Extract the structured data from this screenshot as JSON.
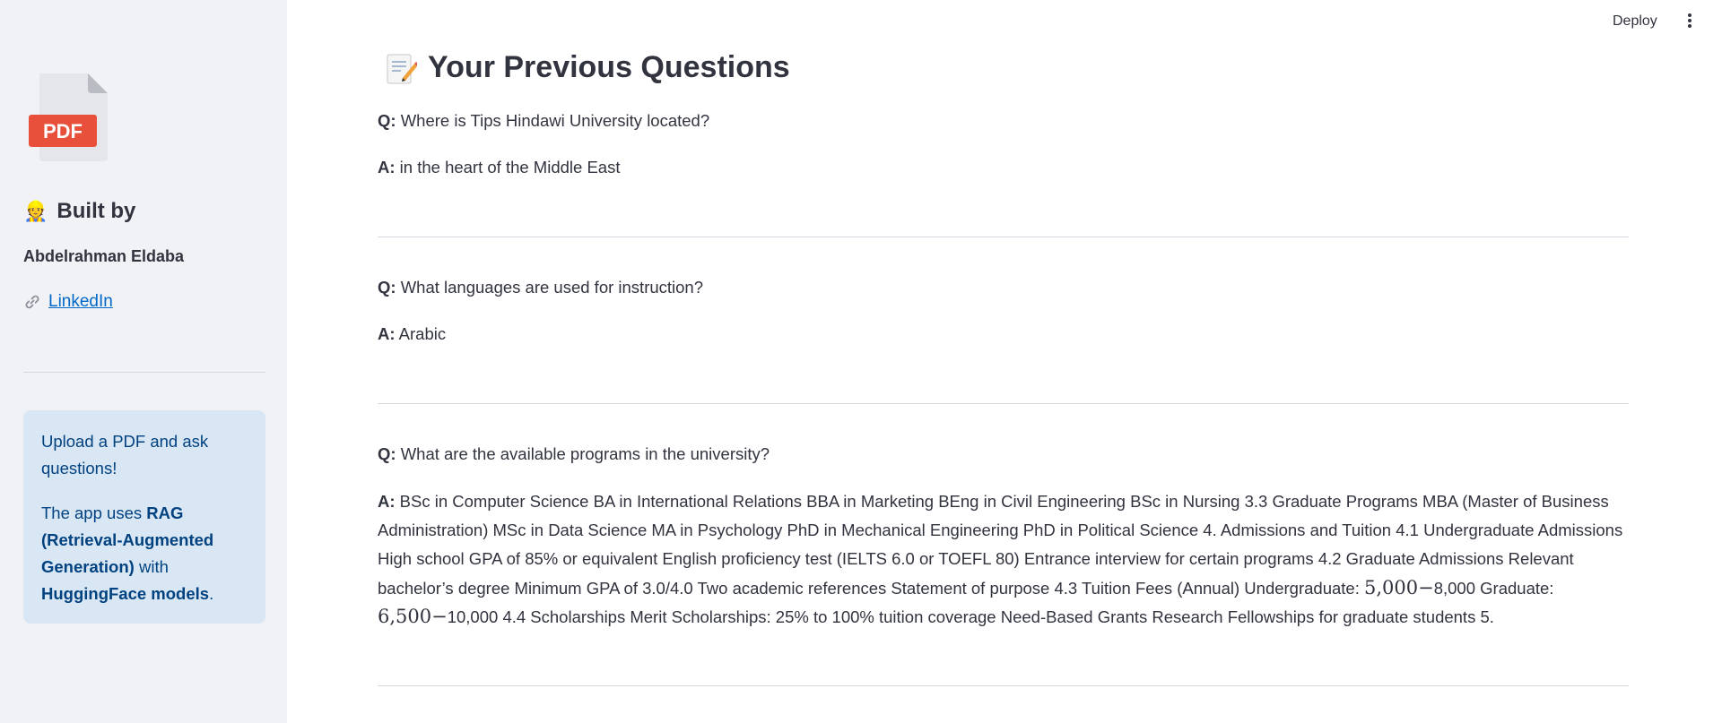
{
  "sidebar": {
    "logo_text": "PDF",
    "built_by_emoji": "👷",
    "built_by_title": "Built by",
    "author": "Abdelrahman Eldaba",
    "link_icon": "link-icon",
    "linkedin_label": "LinkedIn",
    "info": {
      "line1": "Upload a PDF and ask questions!",
      "line2_prefix": "The app uses ",
      "line2_rag": "RAG (Retrieval-Augmented Generation)",
      "line2_mid": " with ",
      "line2_hf": "HuggingFace models",
      "line2_suffix": "."
    }
  },
  "header": {
    "deploy_label": "Deploy",
    "menu_icon": "more-vertical-icon"
  },
  "main": {
    "title": "Your Previous Questions",
    "title_icon": "memo-icon",
    "q_label": "Q:",
    "a_label": "A:",
    "items": [
      {
        "question": "Where is Tips Hindawi University located?",
        "answer": "in the heart of the Middle East"
      },
      {
        "question": "What languages are used for instruction?",
        "answer": "Arabic"
      },
      {
        "question": "What are the available programs in the university?",
        "answer_lines": [
          "BSc in Computer Science BA in International Relations BBA in Marketing BEng in Civil Engineering BSc in Nursing 3.3 Graduate Programs MBA (Master of Business",
          "Administration) MSc in Data Science MA in Psychology PhD in Mechanical Engineering PhD in Political Science 4. Admissions and Tuition 4.1 Undergraduate Admissions",
          "High school GPA of 85% or equivalent English proficiency test (IELTS 6.0 or TOEFL 80) Entrance interview for certain programs 4.2 Graduate Admissions Relevant",
          "bachelor’s degree Minimum GPA of 3.0/4.0 Two academic references Statement of purpose 4.3 Tuition Fees (Annual) Undergraduate: ",
          "10,000 4.4 Scholarships Merit Scholarships: 25% to 100% tuition coverage Need-Based Grants Research Fellowships for graduate students 5."
        ],
        "math1": "5,000−",
        "math1_tail": "8,000 Graduate:",
        "math2": "6,500−"
      }
    ]
  }
}
